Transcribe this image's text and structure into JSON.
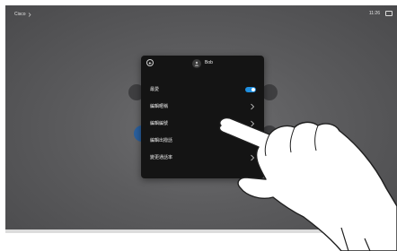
{
  "topbar": {
    "left_label": "Cisco",
    "left_chevron": "chevron-right-icon",
    "time": "11:26",
    "right_icon": "screen-share-icon"
  },
  "contact_panel": {
    "back_icon": "back-arrow-icon",
    "avatar_icon": "person-avatar-icon",
    "name": "Bob",
    "items": [
      {
        "label": "最愛",
        "control": "toggle",
        "toggle_on": true
      },
      {
        "label": "編輯暱稱",
        "control": "chevron"
      },
      {
        "label": "編輯編號",
        "control": "chevron"
      },
      {
        "label": "編輯出撥話",
        "control": "chevron"
      },
      {
        "label": "變更通話率",
        "control": "chevron"
      }
    ]
  },
  "colors": {
    "panel_bg": "#141414",
    "toggle_on": "#1f8fe0",
    "screen_bg": "#5c5c5e"
  }
}
